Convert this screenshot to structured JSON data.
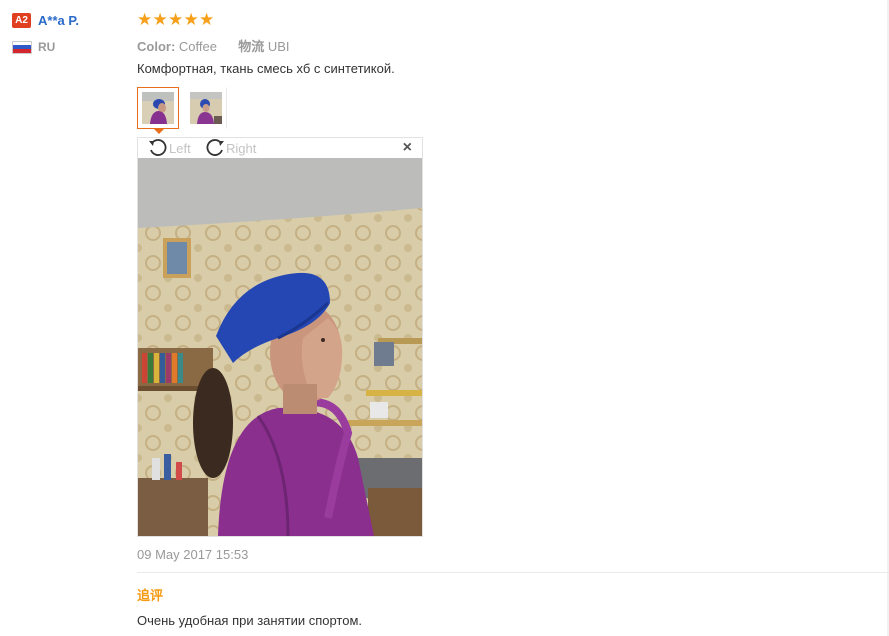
{
  "user": {
    "level": "A2",
    "name": "A**a P.",
    "country": "RU"
  },
  "review": {
    "rating": 5,
    "color_label": "Color:",
    "color_value": "Coffee",
    "logistics_label": "物流",
    "logistics_value": "UBI",
    "text": "Комфортная, ткань смесь хб с синтетикой.",
    "date": "09 May 2017 15:53"
  },
  "viewer": {
    "rotate_left_label": "Left",
    "rotate_right_label": "Right",
    "close_label": "×"
  },
  "followup": {
    "title": "追评",
    "text": "Очень удобная при занятии спортом."
  },
  "colors": {
    "accent": "#e76f1b",
    "star": "#f7a01b",
    "username": "#2a6ac9",
    "badge": "#e0401f",
    "append_title": "#f59a12"
  }
}
